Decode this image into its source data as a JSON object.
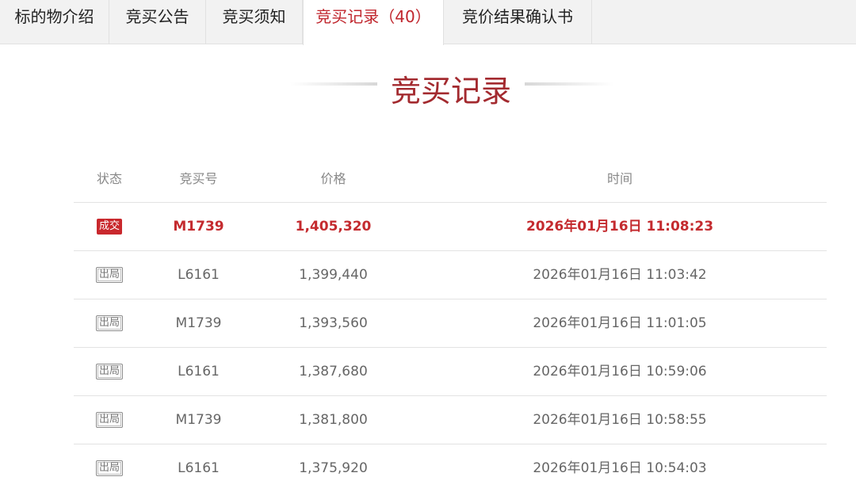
{
  "tabs": [
    {
      "label": "标的物介绍"
    },
    {
      "label": "竞买公告"
    },
    {
      "label": "竞买须知"
    },
    {
      "label": "竞买记录（40）"
    },
    {
      "label": "竞价结果确认书"
    }
  ],
  "active_tab": "竞买记录（40）",
  "section_title": "竞买记录",
  "table": {
    "headers": {
      "status": "状态",
      "bid_no": "竞买号",
      "price": "价格",
      "time": "时间"
    },
    "rows": [
      {
        "status": "成交",
        "bid_no": "M1739",
        "price": "1,405,320",
        "time": "2026年01月16日 11:08:23"
      },
      {
        "status": "出局",
        "bid_no": "L6161",
        "price": "1,399,440",
        "time": "2026年01月16日 11:03:42"
      },
      {
        "status": "出局",
        "bid_no": "M1739",
        "price": "1,393,560",
        "time": "2026年01月16日 11:01:05"
      },
      {
        "status": "出局",
        "bid_no": "L6161",
        "price": "1,387,680",
        "time": "2026年01月16日 10:59:06"
      },
      {
        "status": "出局",
        "bid_no": "M1739",
        "price": "1,381,800",
        "time": "2026年01月16日 10:58:55"
      },
      {
        "status": "出局",
        "bid_no": "L6161",
        "price": "1,375,920",
        "time": "2026年01月16日 10:54:03"
      }
    ]
  },
  "colors": {
    "accent": "#c0262d",
    "title": "#a32a2f",
    "deal_badge": "#c9282d",
    "tab_bar": "#f2f2f2"
  }
}
